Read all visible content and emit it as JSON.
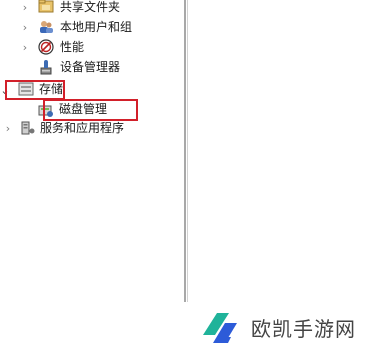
{
  "tree": {
    "items": [
      {
        "label": "共享文件夹",
        "icon": "shared-folder-icon",
        "expander": "›"
      },
      {
        "label": "本地用户和组",
        "icon": "users-group-icon",
        "expander": "›"
      },
      {
        "label": "性能",
        "icon": "performance-icon",
        "expander": "›"
      },
      {
        "label": "设备管理器",
        "icon": "device-manager-icon",
        "expander": ""
      },
      {
        "label": "存储",
        "icon": "storage-icon",
        "expander": "⌄"
      },
      {
        "label": "磁盘管理",
        "icon": "disk-management-icon",
        "expander": ""
      },
      {
        "label": "服务和应用程序",
        "icon": "services-apps-icon",
        "expander": "›"
      }
    ]
  },
  "highlight_color": "#d2202a",
  "watermark": {
    "text": "欧凯手游网",
    "logo": "oukai-logo-icon",
    "logo_colors": [
      "#1fb39a",
      "#2d5bd8"
    ]
  }
}
